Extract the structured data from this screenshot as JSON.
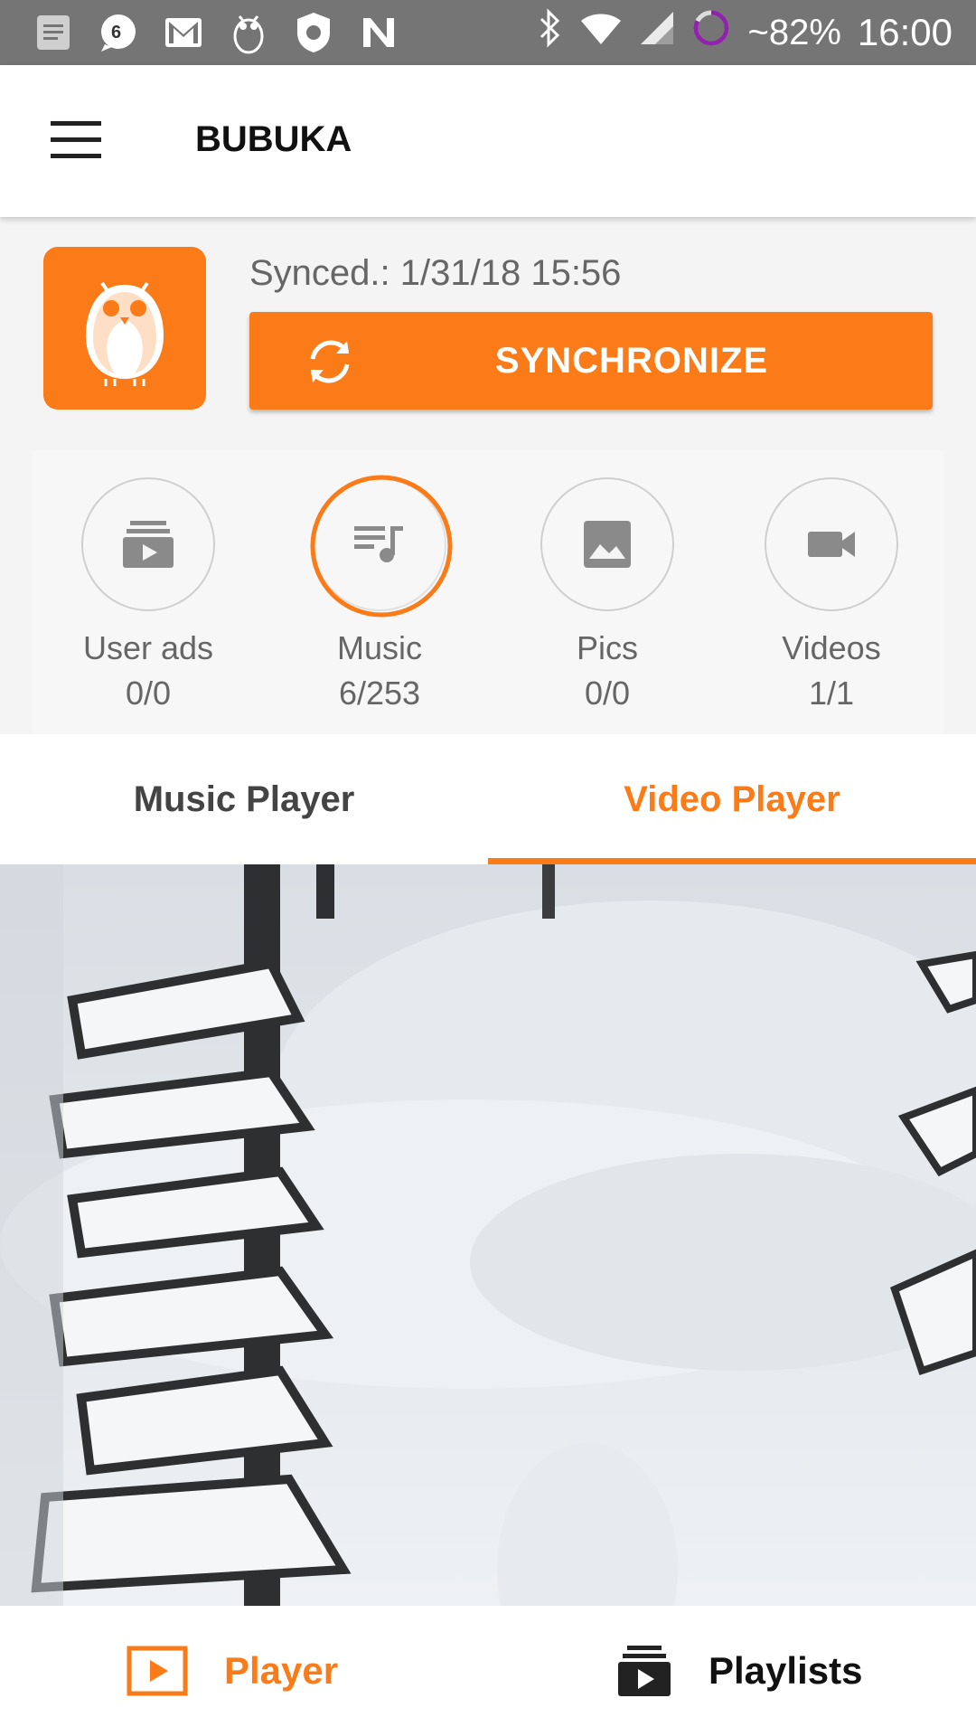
{
  "status_bar": {
    "notification_badge": "6",
    "battery": "~82%",
    "time": "16:00",
    "icons": [
      "notes-icon",
      "chat-bubble-icon",
      "gmail-icon",
      "owl-icon",
      "shield-icon",
      "n-icon",
      "bluetooth-icon",
      "wifi-icon",
      "signal-icon",
      "battery-ring-icon"
    ]
  },
  "app_bar": {
    "title": "BUBUKA",
    "menu_icon": "hamburger-menu-icon"
  },
  "sync": {
    "synced_label": "Synced.: 1/31/18 15:56",
    "button_label": "SYNCHRONIZE",
    "button_icon": "sync-icon",
    "accent_color": "#fa7b17"
  },
  "stats": [
    {
      "name": "User ads",
      "count": "0/0",
      "icon": "playlist-play-icon"
    },
    {
      "name": "Music",
      "count": "6/253",
      "icon": "music-list-icon",
      "progress": 0.024
    },
    {
      "name": "Pics",
      "count": "0/0",
      "icon": "image-icon"
    },
    {
      "name": "Videos",
      "count": "1/1",
      "icon": "videocam-icon"
    }
  ],
  "tabs": {
    "music": "Music Player",
    "video": "Video Player",
    "active": "video"
  },
  "bottom_nav": {
    "player": "Player",
    "playlists": "Playlists",
    "active": "player"
  }
}
